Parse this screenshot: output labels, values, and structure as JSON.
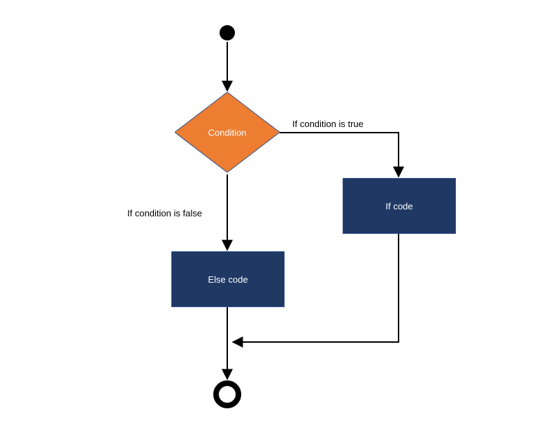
{
  "nodes": {
    "condition": "Condition",
    "if_code": "If code",
    "else_code": "Else code"
  },
  "edges": {
    "true_label": "If condition is true",
    "false_label": "If condition is false"
  },
  "colors": {
    "diamond_fill": "#ed7d31",
    "diamond_stroke": "#2f528f",
    "box_fill": "#1f3864",
    "box_stroke": "#2f528f",
    "arrow": "#000000"
  }
}
